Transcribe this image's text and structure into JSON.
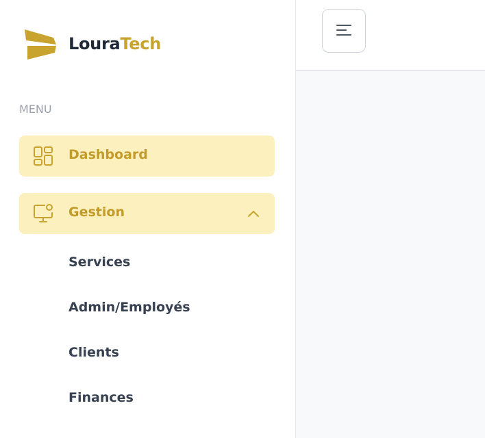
{
  "brand": {
    "part1": "Loura",
    "part2": "Tech",
    "accent": "#c8a42e"
  },
  "sidebar": {
    "menu_label": "MENU",
    "items": [
      {
        "label": "Dashboard",
        "icon": "dashboard-grid-icon",
        "active": true
      },
      {
        "label": "Gestion",
        "icon": "monitor-user-icon",
        "expanded": true,
        "chevron": "chevron-up-icon",
        "children": [
          {
            "label": "Services"
          },
          {
            "label": "Admin/Employés"
          },
          {
            "label": "Clients"
          },
          {
            "label": "Finances"
          }
        ]
      }
    ]
  },
  "topbar": {
    "toggle_icon": "menu-lines-icon"
  },
  "colors": {
    "active_bg": "#fdf0bf",
    "active_text": "#c29b29",
    "text": "#374151"
  }
}
